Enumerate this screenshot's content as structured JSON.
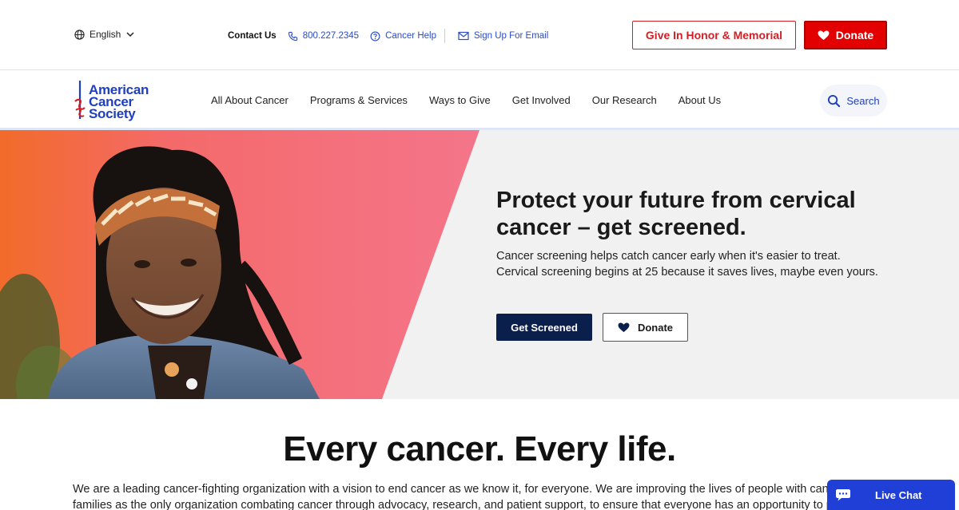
{
  "utility": {
    "language": "English",
    "contact_label": "Contact Us",
    "phone": "800.227.2345",
    "cancer_help": "Cancer Help",
    "sign_up": "Sign Up For Email",
    "honor_button": "Give In Honor & Memorial",
    "donate_button": "Donate"
  },
  "logo": {
    "line1": "American",
    "line2": "Cancer",
    "line3": "Society"
  },
  "nav": {
    "items": [
      {
        "label": "All About Cancer"
      },
      {
        "label": "Programs & Services"
      },
      {
        "label": "Ways to Give"
      },
      {
        "label": "Get Involved"
      },
      {
        "label": "Our Research"
      },
      {
        "label": "About Us"
      }
    ],
    "search_label": "Search"
  },
  "hero": {
    "title": "Protect your future from cervical cancer – get screened.",
    "text_line1": "Cancer screening helps catch cancer early when it's easier to treat.",
    "text_line2": "Cervical screening begins at 25 because it saves lives, maybe even yours.",
    "primary_button": "Get Screened",
    "secondary_button": "Donate"
  },
  "mission": {
    "tagline": "Every cancer. Every life.",
    "line1": "We are a leading cancer-fighting organization with a vision to end cancer as we know it, for everyone. We are improving the lives of people with cance",
    "line2": "families as the only organization combating cancer through advocacy, research, and patient support, to ensure that everyone has an opportunity to p"
  },
  "chat": {
    "label": "Live Chat"
  },
  "colors": {
    "brand_blue": "#1f3fbf",
    "brand_red": "#e20000",
    "navy": "#0b1f4d",
    "chat_blue": "#1f3fd6"
  }
}
